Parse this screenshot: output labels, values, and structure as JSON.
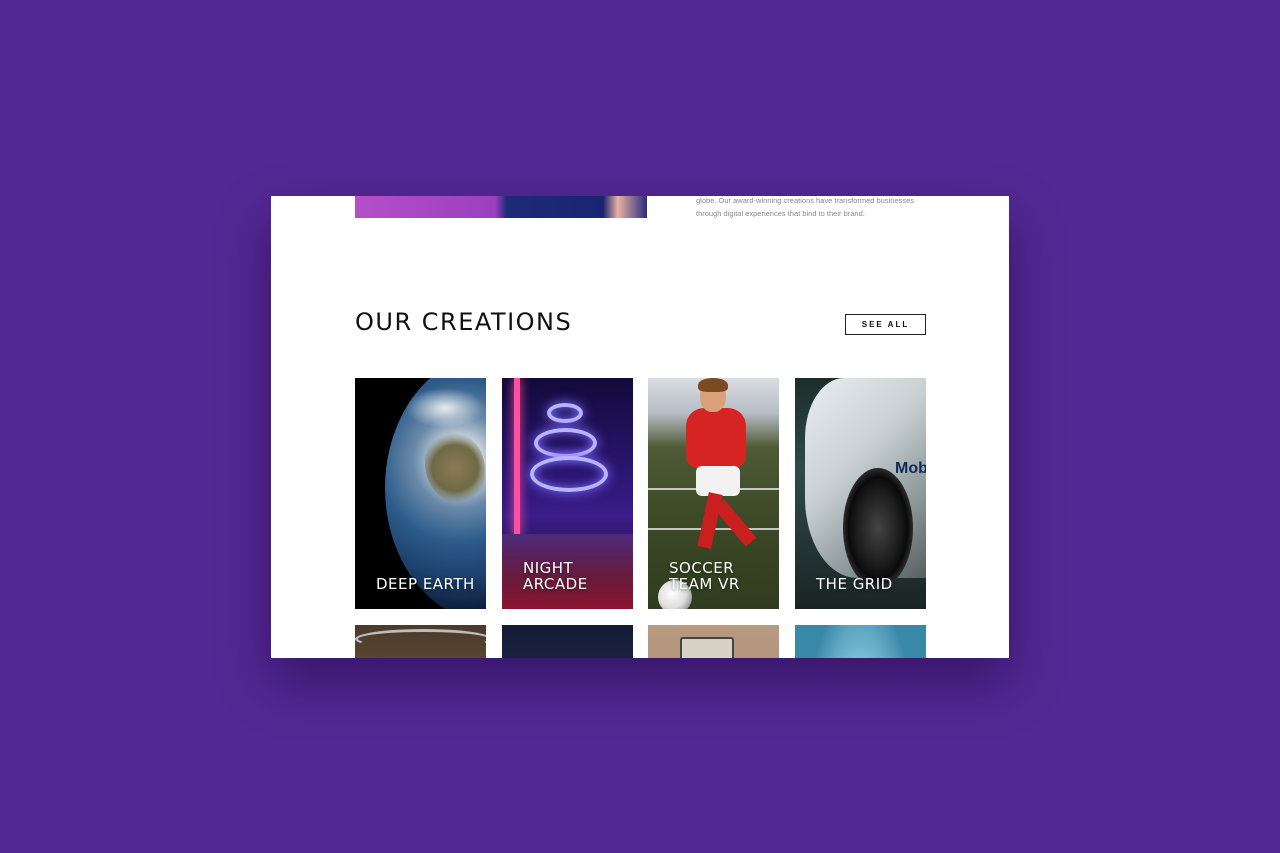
{
  "intro": {
    "text": "globe. Our award-winning creations have transformed businesses through digital experiences that bind to their brand."
  },
  "creations": {
    "title": "OUR CREATIONS",
    "see_all_label": "SEE ALL",
    "items": [
      {
        "title": "DEEP EARTH"
      },
      {
        "title": "NIGHT ARCADE"
      },
      {
        "title": "SOCCER TEAM VR"
      },
      {
        "title": "THE GRID"
      }
    ]
  },
  "colors": {
    "page_background": "#532894",
    "content_background": "#ffffff"
  }
}
